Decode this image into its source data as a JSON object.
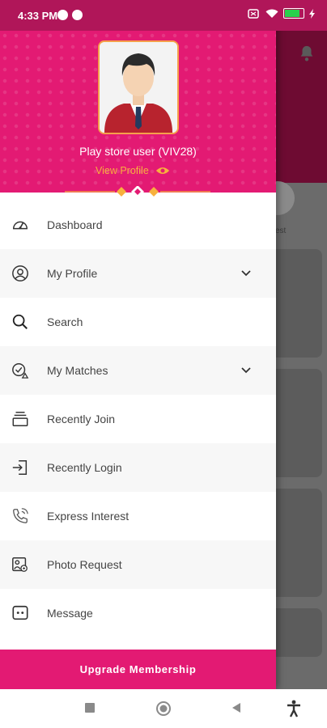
{
  "status_bar": {
    "time": "4:33 PM",
    "battery_level": 0.85,
    "battery_color": "#29d04c"
  },
  "profile": {
    "user_name": "Play store user (VIV28)",
    "view_profile_label": "View Profile"
  },
  "background": {
    "circle_label": "est"
  },
  "menu": {
    "items": [
      {
        "label": "Dashboard",
        "icon": "dashboard-gauge-icon"
      },
      {
        "label": "My Profile",
        "icon": "user-circle-icon",
        "expandable": true
      },
      {
        "label": "Search",
        "icon": "search-icon"
      },
      {
        "label": "My Matches",
        "icon": "matches-check-icon",
        "expandable": true
      },
      {
        "label": "Recently Join",
        "icon": "stack-icon"
      },
      {
        "label": "Recently Login",
        "icon": "login-arrow-icon"
      },
      {
        "label": "Express Interest",
        "icon": "phone-call-icon"
      },
      {
        "label": "Photo Request",
        "icon": "photo-user-icon"
      },
      {
        "label": "Message",
        "icon": "message-dots-icon"
      }
    ]
  },
  "upgrade": {
    "label": "Upgrade Membership"
  },
  "colors": {
    "primary": "#e31a73",
    "status_bar": "#b01659",
    "accent": "#f7b13e",
    "background_header": "#6e0b32"
  },
  "nav": {
    "icons": [
      "recents-square-icon",
      "home-circle-icon",
      "back-triangle-icon",
      "accessibility-icon"
    ]
  }
}
